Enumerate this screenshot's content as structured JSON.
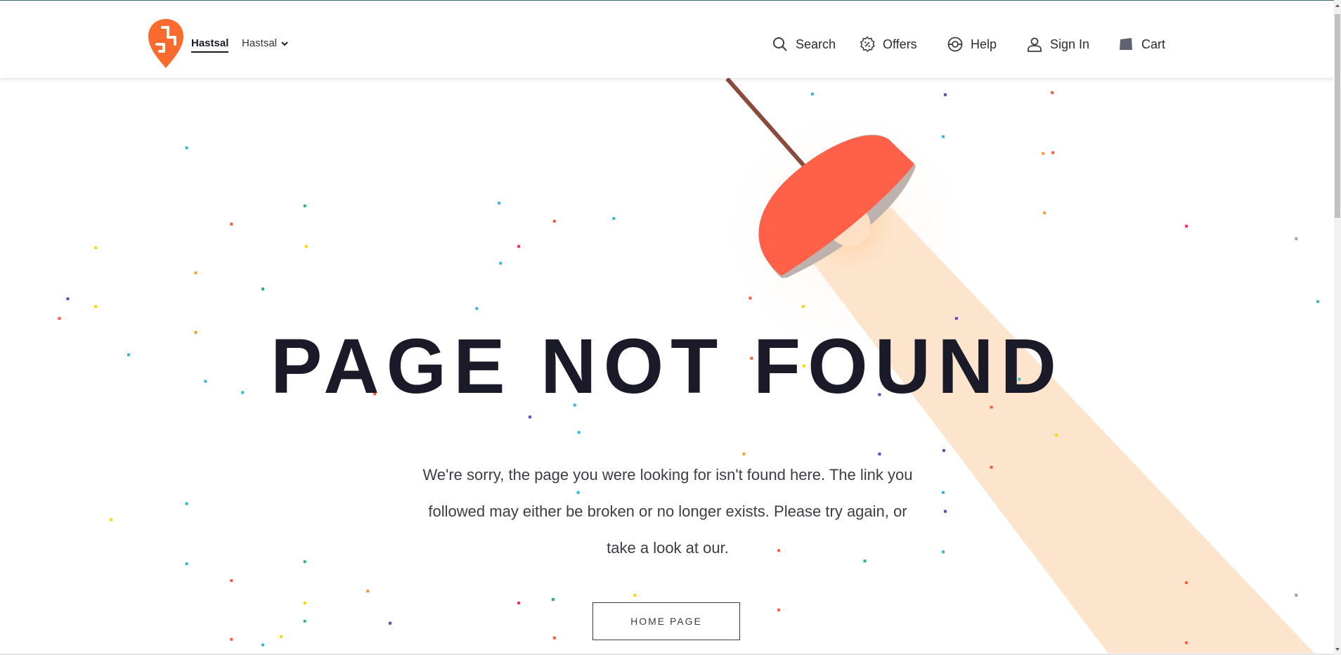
{
  "header": {
    "location_primary": "Hastsal",
    "location_secondary": "Hastsal",
    "nav": {
      "search": "Search",
      "offers": "Offers",
      "help": "Help",
      "signin": "Sign In",
      "cart": "Cart"
    }
  },
  "main": {
    "title": "PAGE NOT FOUND",
    "message": "We're sorry, the page you were looking for isn't found here. The link you followed may either be broken or no longer exists. Please try again, or take a look at our.",
    "home_button": "HOME PAGE"
  },
  "colors": {
    "brand": "#fc6b2d",
    "lamp": "#ff6148",
    "beam": "#fde5cd",
    "title": "#1b1a29"
  },
  "icons": [
    "brand-logo-icon",
    "chevron-down-icon",
    "search-icon",
    "offers-icon",
    "help-icon",
    "user-icon",
    "cart-icon"
  ]
}
